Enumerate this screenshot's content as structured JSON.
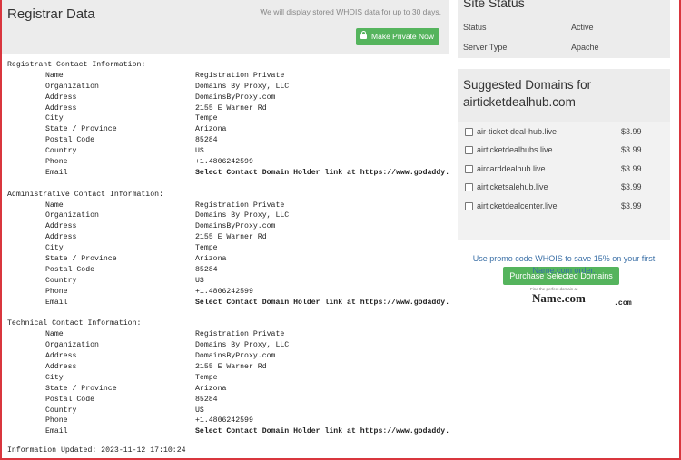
{
  "header": {
    "title": "Registrar Data",
    "note": "We will display stored WHOIS data for up to 30 days.",
    "private_button": "Make Private Now"
  },
  "whois": {
    "sections": [
      {
        "heading": "Registrant Contact Information:",
        "rows": [
          {
            "key": "Name",
            "value": "Registration Private"
          },
          {
            "key": "Organization",
            "value": "Domains By Proxy, LLC"
          },
          {
            "key": "Address",
            "value": "DomainsByProxy.com"
          },
          {
            "key": "Address",
            "value": "2155 E Warner Rd"
          },
          {
            "key": "City",
            "value": "Tempe"
          },
          {
            "key": "State / Province",
            "value": "Arizona"
          },
          {
            "key": "Postal Code",
            "value": "85284"
          },
          {
            "key": "Country",
            "value": "US"
          },
          {
            "key": "Phone",
            "value": "+1.4806242599"
          },
          {
            "key": "Email",
            "value": "Select Contact Domain Holder link at https://www.godaddy.com/whois/results.aspx?domain=airticketdealhub.com"
          }
        ]
      },
      {
        "heading": "Administrative Contact Information:",
        "rows": [
          {
            "key": "Name",
            "value": "Registration Private"
          },
          {
            "key": "Organization",
            "value": "Domains By Proxy, LLC"
          },
          {
            "key": "Address",
            "value": "DomainsByProxy.com"
          },
          {
            "key": "Address",
            "value": "2155 E Warner Rd"
          },
          {
            "key": "City",
            "value": "Tempe"
          },
          {
            "key": "State / Province",
            "value": "Arizona"
          },
          {
            "key": "Postal Code",
            "value": "85284"
          },
          {
            "key": "Country",
            "value": "US"
          },
          {
            "key": "Phone",
            "value": "+1.4806242599"
          },
          {
            "key": "Email",
            "value": "Select Contact Domain Holder link at https://www.godaddy.com/whois/results.asp"
          }
        ]
      },
      {
        "heading": "Technical Contact Information:",
        "rows": [
          {
            "key": "Name",
            "value": "Registration Private"
          },
          {
            "key": "Organization",
            "value": "Domains By Proxy, LLC"
          },
          {
            "key": "Address",
            "value": "DomainsByProxy.com"
          },
          {
            "key": "Address",
            "value": "2155 E Warner Rd"
          },
          {
            "key": "City",
            "value": "Tempe"
          },
          {
            "key": "State / Province",
            "value": "Arizona"
          },
          {
            "key": "Postal Code",
            "value": "85284"
          },
          {
            "key": "Country",
            "value": "US"
          },
          {
            "key": "Phone",
            "value": "+1.4806242599"
          },
          {
            "key": "Email",
            "value": "Select Contact Domain Holder link at https://www.godaddy.com/whois/results.aspx?domain=airticketdealhub.com"
          }
        ]
      }
    ],
    "updated": "Information Updated: 2023-11-12 17:10:24",
    "stray_fragment": ".com"
  },
  "site_status": {
    "title": "Site Status",
    "status_label": "Status",
    "status_value": "Active",
    "server_label": "Server Type",
    "server_value": "Apache"
  },
  "suggested": {
    "title": "Suggested Domains for airticketdealhub.com",
    "domains": [
      {
        "name": "air-ticket-deal-hub.live",
        "price": "$3.99"
      },
      {
        "name": "airticketdealhubs.live",
        "price": "$3.99"
      },
      {
        "name": "aircarddealhub.live",
        "price": "$3.99"
      },
      {
        "name": "airticketsalehub.live",
        "price": "$3.99"
      },
      {
        "name": "airticketdealcenter.live",
        "price": "$3.99"
      }
    ],
    "purchase_button": "Purchase Selected Domains"
  },
  "promo": {
    "text": "Use promo code WHOIS to save 15% on your first Name.com order.",
    "find_text": "Find the perfect domain at",
    "logo_text": "Name.com"
  },
  "colors": {
    "accent_green": "#55b45d",
    "link_blue": "#3a6fa6",
    "panel_gray": "#ececec",
    "border_red": "#d9363e"
  }
}
